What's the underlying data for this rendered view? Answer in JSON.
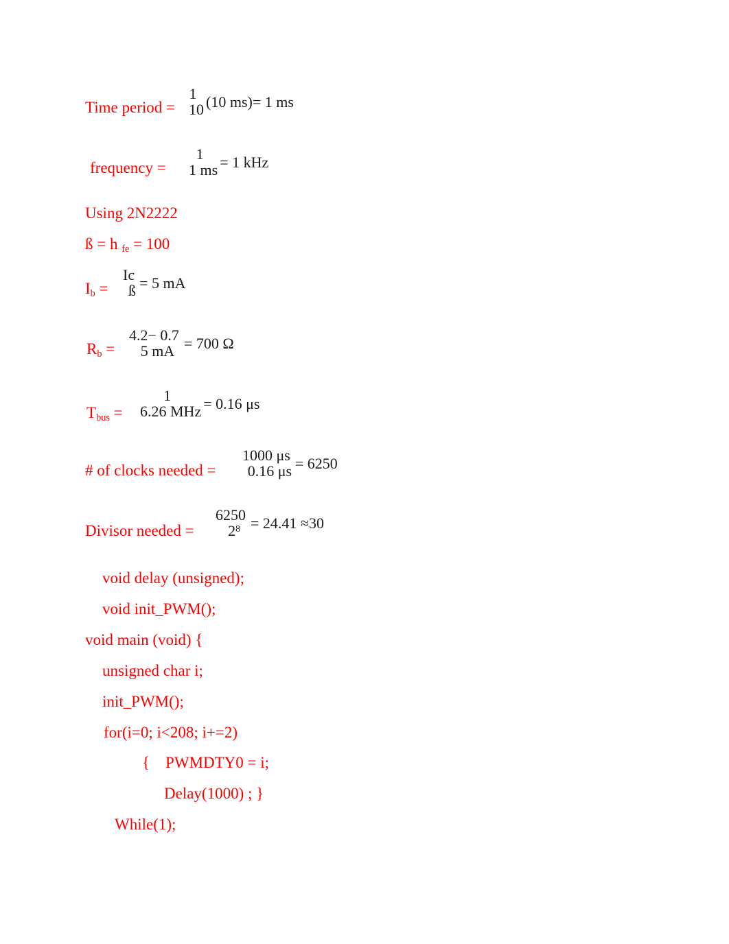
{
  "document": {
    "text_color": "#ff0000",
    "math_color": "#1a1a1a",
    "background": "#ffffff"
  },
  "equations": [
    {
      "id": "time-period",
      "label": "Time period =",
      "numerator": "1",
      "denominator": "10",
      "trailing": "(10 ms)= 1 ms"
    },
    {
      "id": "frequency",
      "label": "frequency =",
      "numerator": "1",
      "denominator": "1 ms",
      "trailing": "= 1 kHz"
    },
    {
      "id": "base-current",
      "label_main": "I",
      "label_sub": "b",
      "label_tail": " =",
      "numerator": "Ic",
      "denominator": "ß",
      "trailing": "= 5 mA"
    },
    {
      "id": "base-resistor",
      "label_main": "R",
      "label_sub": "b",
      "label_tail": " =",
      "numerator": "4.2− 0.7",
      "denominator": "5 mA",
      "trailing": "= 700 Ω"
    },
    {
      "id": "bus-period",
      "label_main": "T",
      "label_sub": "bus",
      "label_tail": "  =",
      "numerator": "1",
      "denominator": "6.26 MHz",
      "trailing": "= 0.16 μs"
    },
    {
      "id": "clocks-needed",
      "label": "# of clocks needed =",
      "numerator": "1000 μs",
      "denominator": "0.16 μs",
      "trailing": "= 6250"
    },
    {
      "id": "divisor-needed",
      "label": "Divisor needed =",
      "numerator": "6250",
      "denominator_base": "2",
      "denominator_exp": "8",
      "trailing": "= 24.41 ≈30"
    }
  ],
  "transistor": {
    "heading": "Using 2N2222",
    "gain_symbol": "ß",
    "gain_eq_1": " = h ",
    "gain_subscript": "fe",
    "gain_eq_2": " = 100"
  },
  "code": {
    "lines": [
      "void delay (unsigned);",
      "void init_PWM();",
      "void main (void) {",
      "unsigned char i;",
      "init_PWM();",
      "for(i=0; i<208; i+=2)",
      "{    PWMDTY0 = i;",
      "Delay(1000) ; }",
      "While(1);"
    ]
  }
}
